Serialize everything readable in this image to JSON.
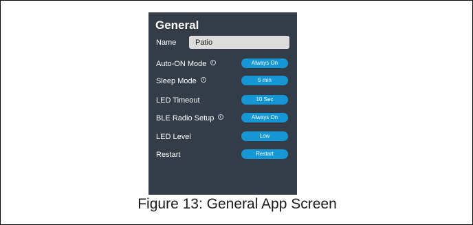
{
  "panel": {
    "title": "General",
    "name_label": "Name",
    "name_value": "Patio",
    "settings": [
      {
        "label": "Auto-ON Mode",
        "info": true,
        "value": "Always On"
      },
      {
        "label": "Sleep Mode",
        "info": true,
        "value": "5 min"
      },
      {
        "label": "LED Timeout",
        "info": false,
        "value": "10 Sec"
      },
      {
        "label": "BLE Radio Setup",
        "info": true,
        "value": "Always On"
      },
      {
        "label": "LED Level",
        "info": false,
        "value": "Low"
      },
      {
        "label": "Restart",
        "info": false,
        "value": "Restart"
      }
    ]
  },
  "caption": "Figure 13: General App Screen",
  "colors": {
    "panel_bg": "#343d47",
    "button_bg": "#1597d6",
    "input_bg": "#dcdcdc"
  }
}
